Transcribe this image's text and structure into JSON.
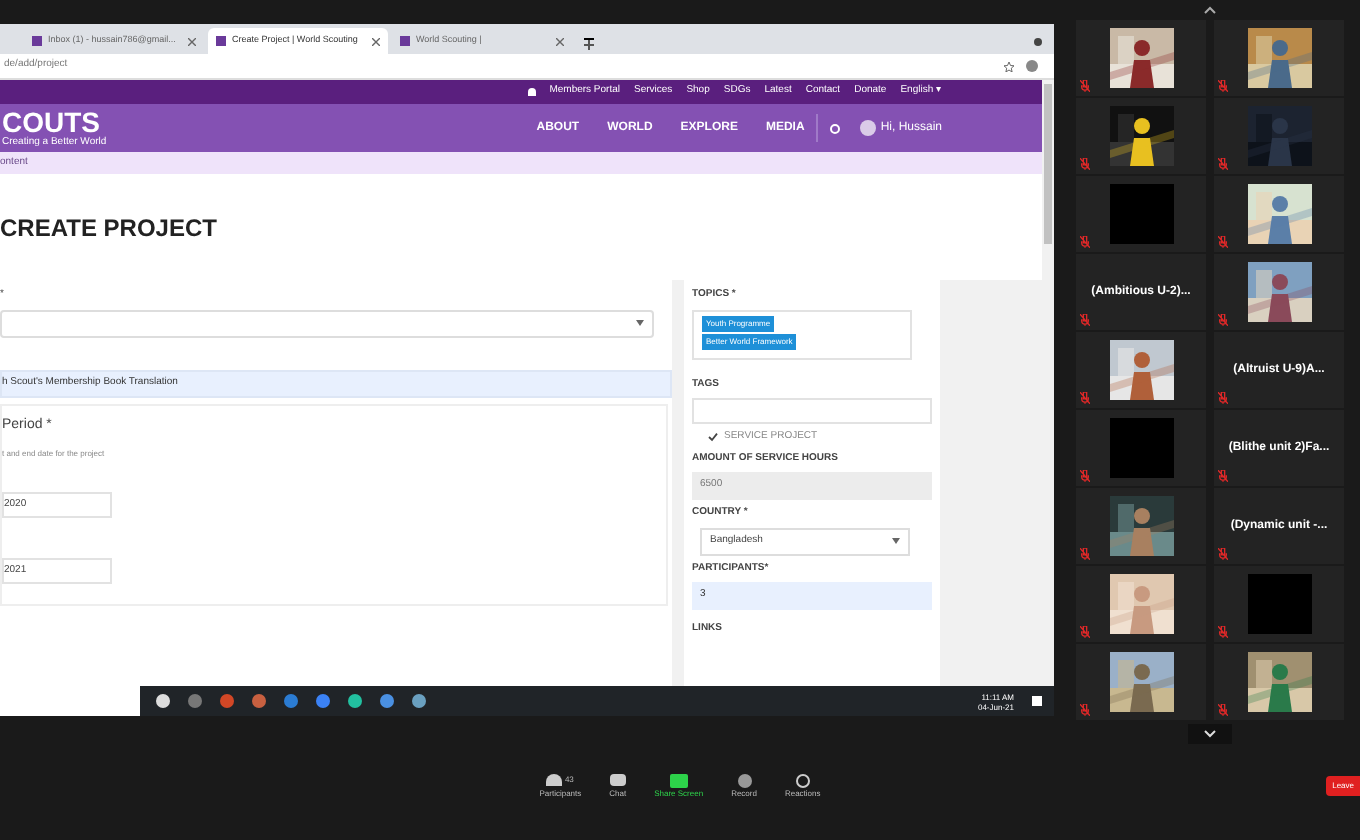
{
  "browser": {
    "tabs": [
      {
        "title": "Inbox (1) - hussain786@gmail...",
        "selected": false
      },
      {
        "title": "Create Project | World Scouting",
        "selected": true
      },
      {
        "title": "World Scouting |",
        "selected": false
      }
    ],
    "address": "de/add/project",
    "top_links": [
      "Members Portal",
      "Services",
      "Shop",
      "SDGs",
      "Latest",
      "Contact",
      "Donate",
      "English ▾"
    ],
    "logo": {
      "text": "COUTS",
      "tagline": "Creating a Better World"
    },
    "nav": [
      "ABOUT",
      "WORLD",
      "EXPLORE",
      "MEDIA"
    ],
    "user": "Hi, Hussain",
    "breadcrumb": "ontent",
    "page_title": "CREATE PROJECT",
    "left": {
      "select_label": "*",
      "title_value": "h Scout's Membership Book Translation",
      "period_heading": "Period *",
      "period_hint": "t and end date for the project",
      "start": "2020",
      "end": "2021"
    },
    "right": {
      "topics_label": "TOPICS *",
      "topics": [
        "Youth Programme",
        "Better World Framework"
      ],
      "tags_label": "TAGS",
      "service": {
        "label": "SERVICE PROJECT",
        "checked": true
      },
      "hours_label": "AMOUNT OF SERVICE HOURS",
      "hours": "6500",
      "country_label": "COUNTRY *",
      "country": "Bangladesh",
      "participants_label": "PARTICIPANTS*",
      "participants": "3",
      "links_label": "LINKS"
    },
    "taskbar": {
      "time": "11:11 AM",
      "date": "04-Jun-21"
    }
  },
  "gallery": [
    {
      "kind": "video",
      "muted": true
    },
    {
      "kind": "video",
      "muted": true
    },
    {
      "kind": "video",
      "muted": true
    },
    {
      "kind": "video",
      "muted": true
    },
    {
      "kind": "dark",
      "muted": true
    },
    {
      "kind": "video",
      "muted": true
    },
    {
      "kind": "name",
      "name": "(Ambitious U-2)...",
      "muted": true
    },
    {
      "kind": "video",
      "muted": true
    },
    {
      "kind": "video",
      "muted": true
    },
    {
      "kind": "name",
      "name": "(Altruist U-9)A...",
      "muted": true
    },
    {
      "kind": "dark",
      "muted": true
    },
    {
      "kind": "name",
      "name": "(Blithe unit 2)Fa...",
      "muted": true
    },
    {
      "kind": "video",
      "muted": true
    },
    {
      "kind": "name",
      "name": "(Dynamic unit -...",
      "muted": true
    },
    {
      "kind": "video",
      "muted": true
    },
    {
      "kind": "dark",
      "muted": true
    },
    {
      "kind": "video",
      "muted": true
    },
    {
      "kind": "video",
      "muted": true
    }
  ],
  "toolbar": {
    "participants_count": "43",
    "buttons": [
      {
        "label": "Participants",
        "kind": "participants"
      },
      {
        "label": "Chat",
        "kind": "chat"
      },
      {
        "label": "Share Screen",
        "kind": "share"
      },
      {
        "label": "Record",
        "kind": "record"
      },
      {
        "label": "Reactions",
        "kind": "reactions"
      }
    ],
    "leave": "Leave"
  }
}
